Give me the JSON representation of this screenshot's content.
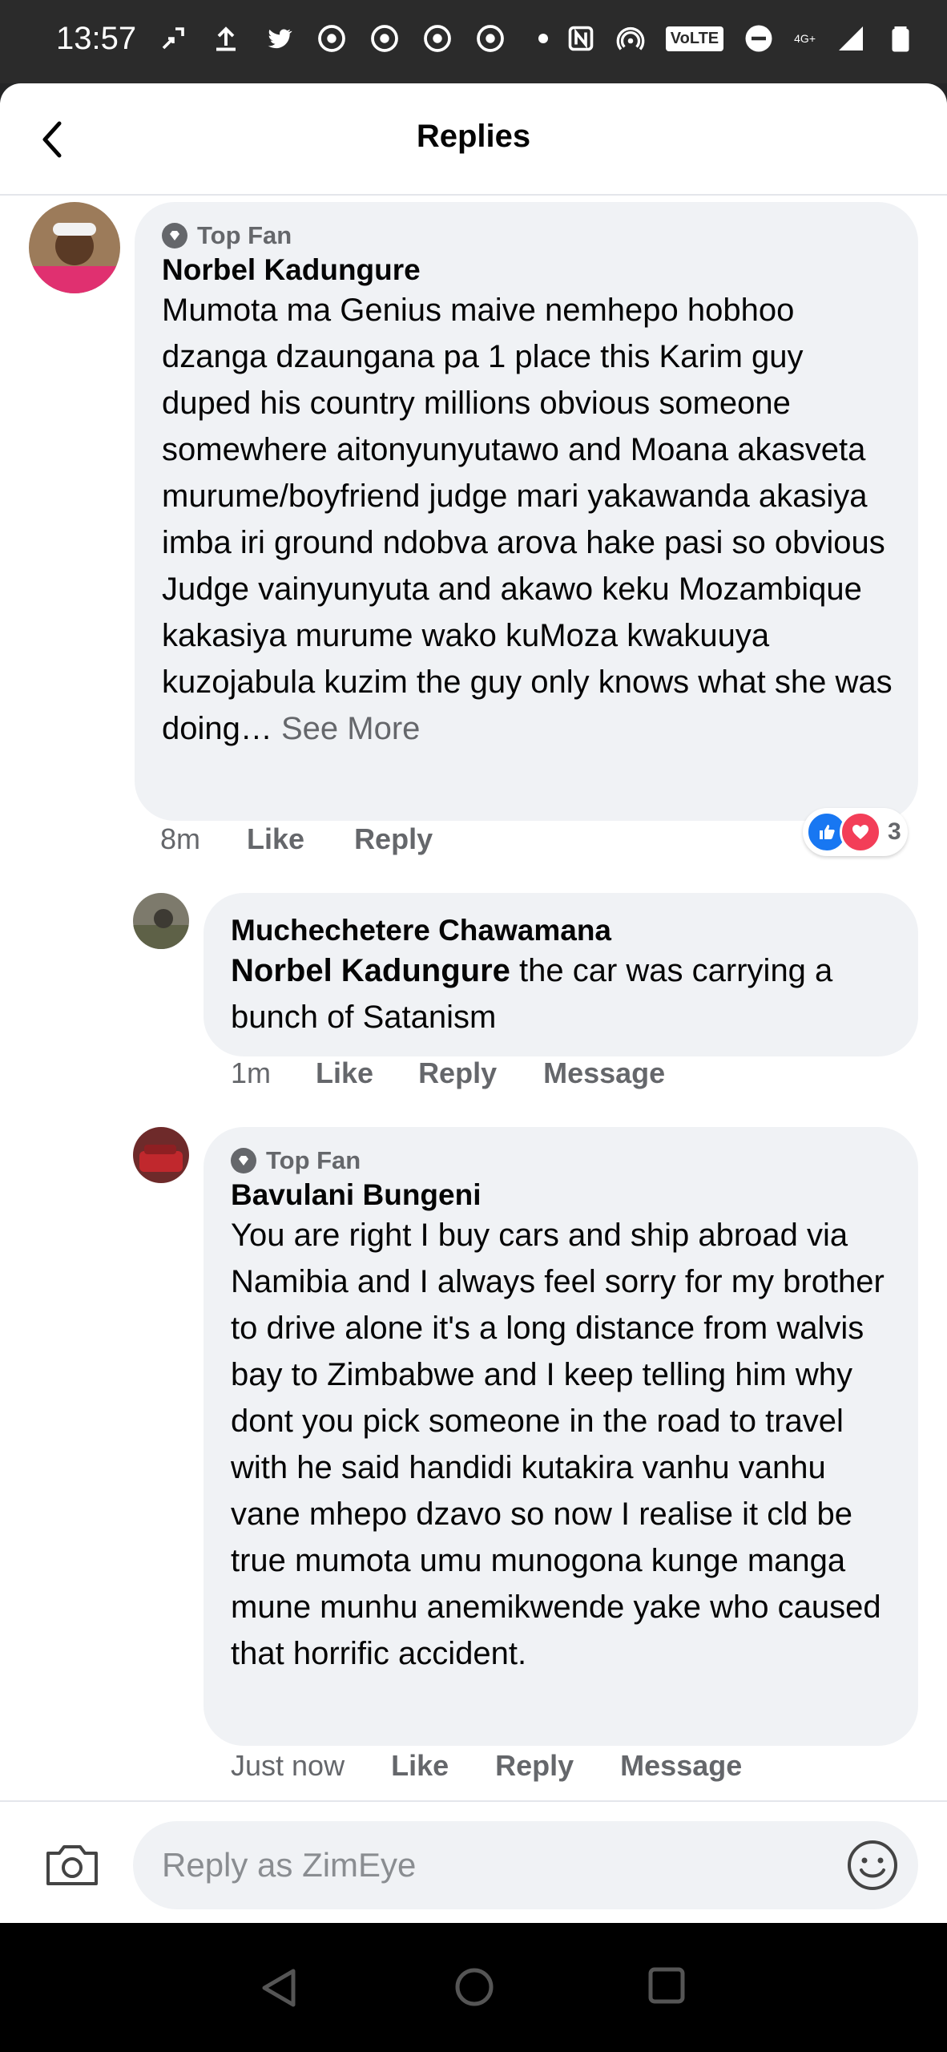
{
  "status_bar": {
    "time": "13:57",
    "left_icons": [
      "cast-icon",
      "upload-icon",
      "twitter-icon",
      "chrome-icon",
      "chrome-icon",
      "chrome-icon",
      "chrome-icon",
      "dot-icon"
    ],
    "volte": "VoLTE",
    "network": "4G+",
    "right_icons": [
      "nfc-icon",
      "hotspot-icon",
      "volte-icon",
      "dnd-icon",
      "signal-icon",
      "battery-icon"
    ]
  },
  "header": {
    "title": "Replies",
    "back_icon": "back-arrow-icon"
  },
  "comments": [
    {
      "top_fan_label": "Top Fan",
      "author": "Norbel Kadungure",
      "text": "Mumota ma Genius maive nemhepo hobhoo dzanga dzaungana pa 1 place this Karim guy duped his country millions obvious someone somewhere aitonyunyutawo and Moana akasveta murume/boyfriend judge mari yakawanda akasiya imba iri ground ndobva arova hake pasi so obvious Judge vainyunyuta and akawo keku Mozambique kakasiya murume wako kuMoza kwakuuya kuzojabula kuzim the guy only knows what she was doing…",
      "see_more": "See More",
      "time": "8m",
      "like": "Like",
      "reply": "Reply",
      "reaction_count": "3"
    },
    {
      "author": "Muchechetere Chawamana",
      "mention": "Norbel Kadungure",
      "text": " the car was carrying a bunch of Satanism",
      "time": "1m",
      "like": "Like",
      "reply": "Reply",
      "message": "Message"
    },
    {
      "top_fan_label": "Top Fan",
      "author": "Bavulani Bungeni",
      "text": "You are right I buy cars and ship abroad via Namibia  and I always feel sorry for my brother  to drive alone it's a long distance from walvis bay to Zimbabwe and I keep telling him why dont you pick someone  in the road to travel with  he said  handidi kutakira vanhu vanhu vane mhepo dzavo so now I realise it cld be true mumota  umu munogona kunge manga mune munhu anemikwende yake who caused that horrific  accident.",
      "time": "Just now",
      "like": "Like",
      "reply": "Reply",
      "message": "Message"
    }
  ],
  "composer": {
    "placeholder": "Reply as ZimEye",
    "camera_icon": "camera-icon",
    "emoji_icon": "emoji-icon"
  },
  "navbar": {
    "icons": [
      "nav-back-icon",
      "nav-home-icon",
      "nav-recents-icon"
    ]
  },
  "colors": {
    "like_blue": "#1877f2",
    "love_red": "#f33e58",
    "bubble_gray": "#f0f2f5",
    "secondary_text": "#65676b"
  }
}
